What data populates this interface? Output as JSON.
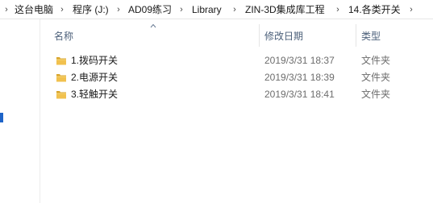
{
  "breadcrumb": {
    "items": [
      "这台电脑",
      "程序 (J:)",
      "AD09练习",
      "Library",
      "ZIN-3D集成库工程",
      "14.各类开关"
    ]
  },
  "columns": {
    "name": "名称",
    "date": "修改日期",
    "type": "类型",
    "sorted_by": "name",
    "sort_direction": "ascending"
  },
  "files": [
    {
      "name": "1.拨码开关",
      "date": "2019/3/31 18:37",
      "type": "文件夹",
      "icon": "folder-icon"
    },
    {
      "name": "2.电源开关",
      "date": "2019/3/31 18:39",
      "type": "文件夹",
      "icon": "folder-icon"
    },
    {
      "name": "3.轻触开关",
      "date": "2019/3/31 18:41",
      "type": "文件夹",
      "icon": "folder-icon"
    }
  ],
  "colors": {
    "folder": "#e9b841",
    "header_text": "#4c607a",
    "secondary_text": "#6d6d6d"
  }
}
